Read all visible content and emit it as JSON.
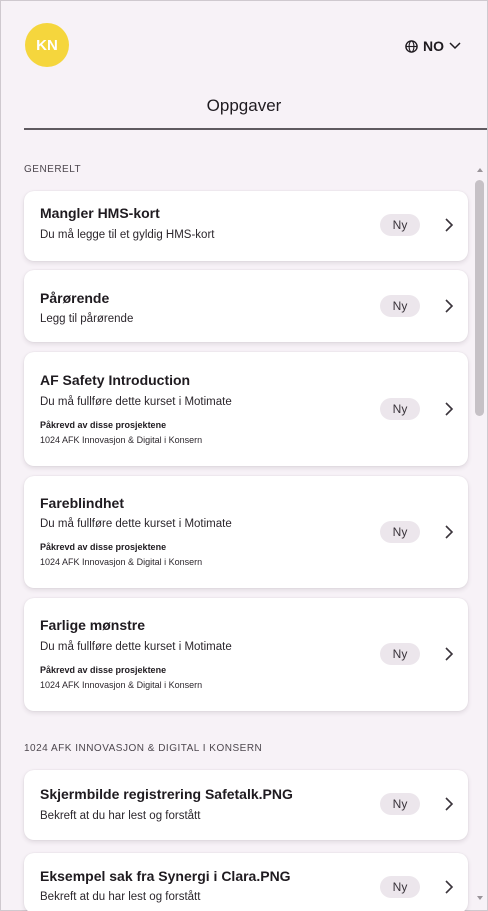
{
  "header": {
    "avatar_initials": "KN",
    "avatar_color": "#f5d63d",
    "language": "NO",
    "language_icon": "globe-icon",
    "dropdown_icon": "chevron-down-icon",
    "title": "Oppgaver"
  },
  "sections": [
    {
      "label": "GENERELT",
      "cards": [
        {
          "title": "Mangler HMS-kort",
          "subtitle": "Du må legge til et gyldig HMS-kort",
          "badge": "Ny"
        },
        {
          "title": "Pårørende",
          "subtitle": "Legg til pårørende",
          "badge": "Ny"
        },
        {
          "title": "AF Safety Introduction",
          "subtitle": "Du må fullføre dette kurset i Motimate",
          "required_label": "Påkrevd av disse prosjektene",
          "required_value": "1024 AFK Innovasjon & Digital i Konsern",
          "badge": "Ny"
        },
        {
          "title": "Fareblindhet",
          "subtitle": "Du må fullføre dette kurset i Motimate",
          "required_label": "Påkrevd av disse prosjektene",
          "required_value": "1024 AFK Innovasjon & Digital i Konsern",
          "badge": "Ny"
        },
        {
          "title": "Farlige mønstre",
          "subtitle": "Du må fullføre dette kurset i Motimate",
          "required_label": "Påkrevd av disse prosjektene",
          "required_value": "1024 AFK Innovasjon & Digital i Konsern",
          "badge": "Ny"
        }
      ]
    },
    {
      "label": "1024 AFK INNOVASJON & DIGITAL I KONSERN",
      "cards": [
        {
          "title": "Skjermbilde registrering Safetalk.PNG",
          "subtitle": "Bekreft at du har lest og forstått",
          "badge": "Ny"
        },
        {
          "title": "Eksempel sak fra Synergi i Clara.PNG",
          "subtitle": "Bekreft at du har lest og forstått",
          "badge": "Ny"
        }
      ]
    }
  ]
}
